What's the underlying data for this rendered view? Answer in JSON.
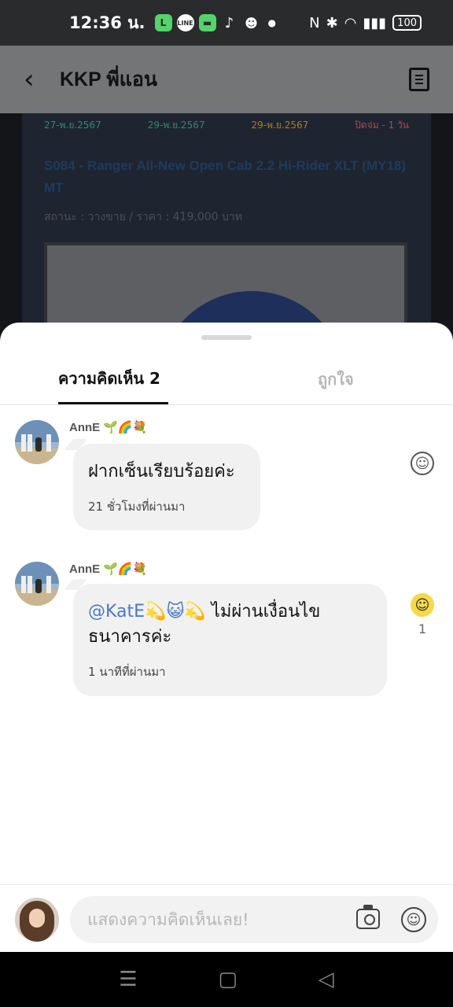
{
  "status_bar": {
    "time": "12:36 น.",
    "app_icons": [
      "line-icon",
      "line-icon",
      "messages-icon",
      "tiktok-icon",
      "reddit-icon"
    ],
    "battery": "100"
  },
  "header": {
    "title": "KKP พี่แอน"
  },
  "post": {
    "dates": [
      "27-พ.ย.2567",
      "29-พ.ย.2567",
      "29-พ.ย.2567",
      "ปิดจ่ม - 1 วัน"
    ],
    "date_colors": [
      "#2f8b6a",
      "#2f8b6a",
      "#b07b2a",
      "#b04a4a"
    ],
    "title": "S084 - Ranger All-New Open Cab 2.2 Hi-Rider XLT (MY18) MT",
    "meta": "สถานะ : วางขาย / ราคา : 419,000 บาท"
  },
  "tabs": {
    "comments": "ความคิดเห็น 2",
    "likes": "ถูกใจ"
  },
  "comments": [
    {
      "author": "AnnE",
      "author_emoji": "🌱🌈💐",
      "text": "ฝากเซ็นเรียบร้อยค่ะ",
      "time": "21 ชั่วโมงที่ผ่านมา",
      "reaction_count": ""
    },
    {
      "author": "AnnE",
      "author_emoji": "🌱🌈💐",
      "mention": "@KatE💫😺💫",
      "text": " ไม่ผ่านเงื่อนไขธนาคารค่ะ",
      "time": "1 นาทีที่ผ่านมา",
      "reaction_count": "1"
    }
  ],
  "composer": {
    "placeholder": "แสดงความคิดเห็นเลย!"
  },
  "nav": {
    "menu": "☰",
    "home": "▢",
    "back": "◁"
  }
}
